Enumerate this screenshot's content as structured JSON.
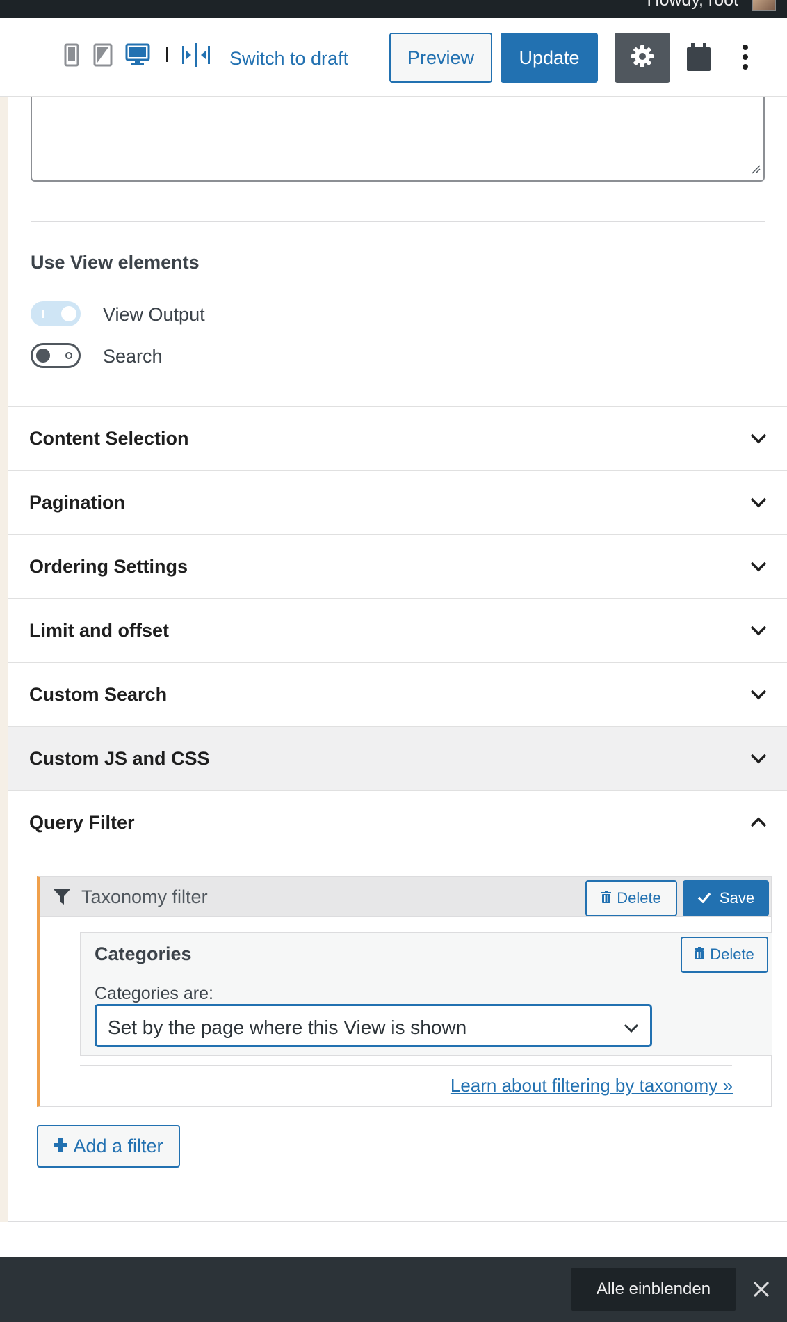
{
  "adminbar": {
    "howdy": "Howdy, root"
  },
  "toolbar": {
    "switch_to_draft": "Switch to draft",
    "preview": "Preview",
    "update": "Update"
  },
  "view_elements": {
    "heading": "Use View elements",
    "toggles": [
      {
        "label": "View Output",
        "state": "on"
      },
      {
        "label": "Search",
        "state": "off"
      }
    ]
  },
  "accordion": [
    {
      "label": "Content Selection",
      "expanded": false
    },
    {
      "label": "Pagination",
      "expanded": false
    },
    {
      "label": "Ordering Settings",
      "expanded": false
    },
    {
      "label": "Limit and offset",
      "expanded": false
    },
    {
      "label": "Custom Search",
      "expanded": false
    },
    {
      "label": "Custom JS and CSS",
      "expanded": false
    },
    {
      "label": "Query Filter",
      "expanded": true
    }
  ],
  "query_filter": {
    "filter_title": "Taxonomy filter",
    "delete": "Delete",
    "save": "Save",
    "category": {
      "title": "Categories",
      "delete": "Delete",
      "field_label": "Categories are:",
      "selected": "Set by the page where this View is shown"
    },
    "learn_link": "Learn about filtering by taxonomy »",
    "add_filter": "Add a filter"
  },
  "footer": {
    "show_all": "Alle einblenden"
  },
  "colors": {
    "accent": "#2271b1",
    "admin_bar": "#1d2327",
    "footer": "#2c3338",
    "filter_marker": "#f0a04b"
  },
  "icons": [
    "mobile-preview-icon",
    "tablet-preview-icon",
    "desktop-preview-icon",
    "split-view-icon",
    "gear-icon",
    "clipboard-icon",
    "more-vertical-icon",
    "chevron-down-icon",
    "chevron-up-icon",
    "funnel-icon",
    "trash-icon",
    "check-icon",
    "plus-icon",
    "close-icon"
  ]
}
